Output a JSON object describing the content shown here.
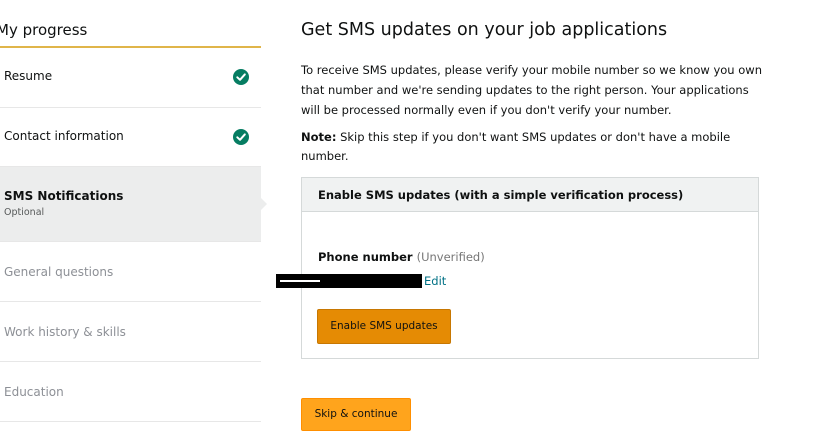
{
  "sidebar": {
    "title": "My progress",
    "steps": [
      {
        "label": "Resume",
        "sub": "",
        "state": "complete"
      },
      {
        "label": "Contact information",
        "sub": "",
        "state": "complete"
      },
      {
        "label": "SMS Notifications",
        "sub": "Optional",
        "state": "active"
      },
      {
        "label": "General questions",
        "sub": "",
        "state": "pending"
      },
      {
        "label": "Work history & skills",
        "sub": "",
        "state": "pending"
      },
      {
        "label": "Education",
        "sub": "",
        "state": "pending"
      }
    ]
  },
  "main": {
    "title": "Get SMS updates on your job applications",
    "intro": "To receive SMS updates, please verify your mobile number so we know you own that number and we're sending updates to the right person. Your applications will be processed normally even if you don't verify your number.",
    "note_label": "Note:",
    "note_text": " Skip this step if you don't want SMS updates or don't have a mobile number.",
    "panel": {
      "title": "Enable SMS updates (with a simple verification process)",
      "phone_label": "Phone number",
      "phone_status": "(Unverified)",
      "edit_link": "Edit",
      "enable_button": "Enable SMS updates"
    },
    "skip_button": "Skip & continue"
  },
  "colors": {
    "accent_orange": "#ffa41c",
    "enable_button": "#e58b04",
    "check_green": "#067d62",
    "link": "#007185",
    "active_step_bg": "#eceded"
  },
  "icons": {
    "complete": "check-circle-icon"
  }
}
